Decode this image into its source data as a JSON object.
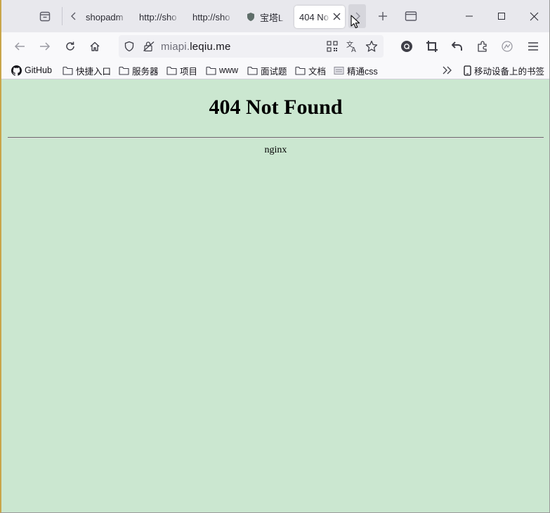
{
  "tabs": [
    {
      "title": "shopadm",
      "active": false
    },
    {
      "title": "http://sho",
      "active": false
    },
    {
      "title": "http://sho",
      "active": false
    },
    {
      "title": "宝塔L",
      "active": false
    },
    {
      "title": "404 No",
      "active": true
    }
  ],
  "address_bar": {
    "url_prefix": "miapi.",
    "url_host": "leqiu.me"
  },
  "bookmarks": [
    {
      "label": "GitHub",
      "icon": "github-icon"
    },
    {
      "label": "快捷入口",
      "icon": "folder-icon"
    },
    {
      "label": "服务器",
      "icon": "folder-icon"
    },
    {
      "label": "项目",
      "icon": "folder-icon"
    },
    {
      "label": "www",
      "icon": "folder-icon"
    },
    {
      "label": "面试题",
      "icon": "folder-icon"
    },
    {
      "label": "文档",
      "icon": "folder-icon"
    },
    {
      "label": "精通css",
      "icon": "page-icon"
    }
  ],
  "mobile_bookmarks": "移动设备上的书签",
  "page": {
    "heading": "404 Not Found",
    "server": "nginx"
  },
  "colors": {
    "page_background": "#cbe7d0",
    "tabbar": "#e8e8ed",
    "toolbar": "#f9f9fb"
  }
}
